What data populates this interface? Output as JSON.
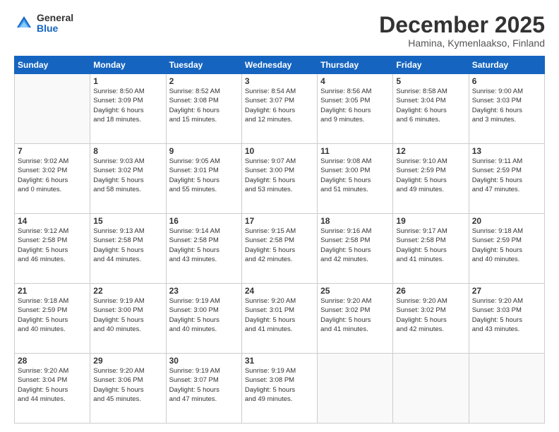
{
  "logo": {
    "general": "General",
    "blue": "Blue"
  },
  "title": "December 2025",
  "subtitle": "Hamina, Kymenlaakso, Finland",
  "days_header": [
    "Sunday",
    "Monday",
    "Tuesday",
    "Wednesday",
    "Thursday",
    "Friday",
    "Saturday"
  ],
  "weeks": [
    [
      {
        "day": "",
        "info": ""
      },
      {
        "day": "1",
        "info": "Sunrise: 8:50 AM\nSunset: 3:09 PM\nDaylight: 6 hours\nand 18 minutes."
      },
      {
        "day": "2",
        "info": "Sunrise: 8:52 AM\nSunset: 3:08 PM\nDaylight: 6 hours\nand 15 minutes."
      },
      {
        "day": "3",
        "info": "Sunrise: 8:54 AM\nSunset: 3:07 PM\nDaylight: 6 hours\nand 12 minutes."
      },
      {
        "day": "4",
        "info": "Sunrise: 8:56 AM\nSunset: 3:05 PM\nDaylight: 6 hours\nand 9 minutes."
      },
      {
        "day": "5",
        "info": "Sunrise: 8:58 AM\nSunset: 3:04 PM\nDaylight: 6 hours\nand 6 minutes."
      },
      {
        "day": "6",
        "info": "Sunrise: 9:00 AM\nSunset: 3:03 PM\nDaylight: 6 hours\nand 3 minutes."
      }
    ],
    [
      {
        "day": "7",
        "info": "Sunrise: 9:02 AM\nSunset: 3:02 PM\nDaylight: 6 hours\nand 0 minutes."
      },
      {
        "day": "8",
        "info": "Sunrise: 9:03 AM\nSunset: 3:02 PM\nDaylight: 5 hours\nand 58 minutes."
      },
      {
        "day": "9",
        "info": "Sunrise: 9:05 AM\nSunset: 3:01 PM\nDaylight: 5 hours\nand 55 minutes."
      },
      {
        "day": "10",
        "info": "Sunrise: 9:07 AM\nSunset: 3:00 PM\nDaylight: 5 hours\nand 53 minutes."
      },
      {
        "day": "11",
        "info": "Sunrise: 9:08 AM\nSunset: 3:00 PM\nDaylight: 5 hours\nand 51 minutes."
      },
      {
        "day": "12",
        "info": "Sunrise: 9:10 AM\nSunset: 2:59 PM\nDaylight: 5 hours\nand 49 minutes."
      },
      {
        "day": "13",
        "info": "Sunrise: 9:11 AM\nSunset: 2:59 PM\nDaylight: 5 hours\nand 47 minutes."
      }
    ],
    [
      {
        "day": "14",
        "info": "Sunrise: 9:12 AM\nSunset: 2:58 PM\nDaylight: 5 hours\nand 46 minutes."
      },
      {
        "day": "15",
        "info": "Sunrise: 9:13 AM\nSunset: 2:58 PM\nDaylight: 5 hours\nand 44 minutes."
      },
      {
        "day": "16",
        "info": "Sunrise: 9:14 AM\nSunset: 2:58 PM\nDaylight: 5 hours\nand 43 minutes."
      },
      {
        "day": "17",
        "info": "Sunrise: 9:15 AM\nSunset: 2:58 PM\nDaylight: 5 hours\nand 42 minutes."
      },
      {
        "day": "18",
        "info": "Sunrise: 9:16 AM\nSunset: 2:58 PM\nDaylight: 5 hours\nand 42 minutes."
      },
      {
        "day": "19",
        "info": "Sunrise: 9:17 AM\nSunset: 2:58 PM\nDaylight: 5 hours\nand 41 minutes."
      },
      {
        "day": "20",
        "info": "Sunrise: 9:18 AM\nSunset: 2:59 PM\nDaylight: 5 hours\nand 40 minutes."
      }
    ],
    [
      {
        "day": "21",
        "info": "Sunrise: 9:18 AM\nSunset: 2:59 PM\nDaylight: 5 hours\nand 40 minutes."
      },
      {
        "day": "22",
        "info": "Sunrise: 9:19 AM\nSunset: 3:00 PM\nDaylight: 5 hours\nand 40 minutes."
      },
      {
        "day": "23",
        "info": "Sunrise: 9:19 AM\nSunset: 3:00 PM\nDaylight: 5 hours\nand 40 minutes."
      },
      {
        "day": "24",
        "info": "Sunrise: 9:20 AM\nSunset: 3:01 PM\nDaylight: 5 hours\nand 41 minutes."
      },
      {
        "day": "25",
        "info": "Sunrise: 9:20 AM\nSunset: 3:02 PM\nDaylight: 5 hours\nand 41 minutes."
      },
      {
        "day": "26",
        "info": "Sunrise: 9:20 AM\nSunset: 3:02 PM\nDaylight: 5 hours\nand 42 minutes."
      },
      {
        "day": "27",
        "info": "Sunrise: 9:20 AM\nSunset: 3:03 PM\nDaylight: 5 hours\nand 43 minutes."
      }
    ],
    [
      {
        "day": "28",
        "info": "Sunrise: 9:20 AM\nSunset: 3:04 PM\nDaylight: 5 hours\nand 44 minutes."
      },
      {
        "day": "29",
        "info": "Sunrise: 9:20 AM\nSunset: 3:06 PM\nDaylight: 5 hours\nand 45 minutes."
      },
      {
        "day": "30",
        "info": "Sunrise: 9:19 AM\nSunset: 3:07 PM\nDaylight: 5 hours\nand 47 minutes."
      },
      {
        "day": "31",
        "info": "Sunrise: 9:19 AM\nSunset: 3:08 PM\nDaylight: 5 hours\nand 49 minutes."
      },
      {
        "day": "",
        "info": ""
      },
      {
        "day": "",
        "info": ""
      },
      {
        "day": "",
        "info": ""
      }
    ]
  ]
}
